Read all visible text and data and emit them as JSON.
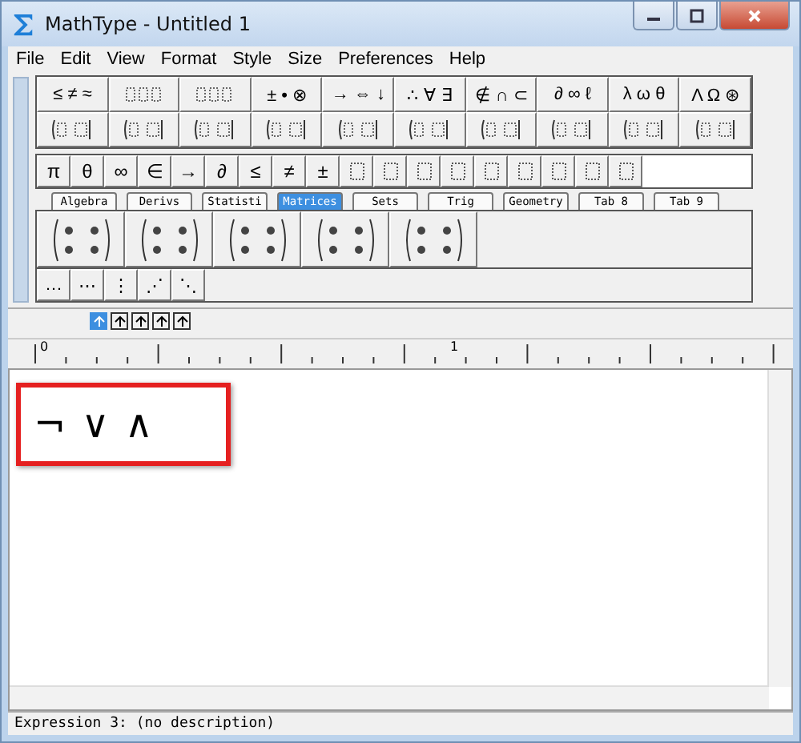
{
  "window": {
    "title": "MathType - Untitled 1"
  },
  "menu": [
    "File",
    "Edit",
    "View",
    "Format",
    "Style",
    "Size",
    "Preferences",
    "Help"
  ],
  "symbol_palettes": [
    {
      "kind": "text",
      "label": "≤ ≠ ≈"
    },
    {
      "kind": "icon"
    },
    {
      "kind": "icon"
    },
    {
      "kind": "text",
      "label": "± • ⊗"
    },
    {
      "kind": "text",
      "label": "→ ⇔ ↓"
    },
    {
      "kind": "text",
      "label": "∴ ∀ ∃"
    },
    {
      "kind": "text",
      "label": "∉ ∩ ⊂"
    },
    {
      "kind": "text",
      "label": "∂ ∞ ℓ"
    },
    {
      "kind": "text",
      "label": "λ ω θ"
    },
    {
      "kind": "text",
      "label": "Λ Ω ⊛"
    }
  ],
  "template_palettes": [
    {
      "kind": "icon"
    },
    {
      "kind": "icon"
    },
    {
      "kind": "icon"
    },
    {
      "kind": "icon"
    },
    {
      "kind": "icon"
    },
    {
      "kind": "icon"
    },
    {
      "kind": "icon"
    },
    {
      "kind": "icon"
    },
    {
      "kind": "icon"
    },
    {
      "kind": "icon"
    }
  ],
  "small_bar": [
    {
      "kind": "text",
      "label": "π"
    },
    {
      "kind": "text",
      "label": "θ"
    },
    {
      "kind": "text",
      "label": "∞"
    },
    {
      "kind": "text",
      "label": "∈"
    },
    {
      "kind": "text",
      "label": "→"
    },
    {
      "kind": "text",
      "label": "∂"
    },
    {
      "kind": "text",
      "label": "≤"
    },
    {
      "kind": "text",
      "label": "≠"
    },
    {
      "kind": "text",
      "label": "±"
    },
    {
      "kind": "icon"
    },
    {
      "kind": "icon"
    },
    {
      "kind": "icon"
    },
    {
      "kind": "icon"
    },
    {
      "kind": "icon"
    },
    {
      "kind": "icon"
    },
    {
      "kind": "icon"
    },
    {
      "kind": "icon"
    },
    {
      "kind": "icon"
    }
  ],
  "tabs": [
    {
      "label": "Algebra",
      "selected": false
    },
    {
      "label": "Derivs",
      "selected": false
    },
    {
      "label": "Statisti",
      "selected": false
    },
    {
      "label": "Matrices",
      "selected": true
    },
    {
      "label": "Sets",
      "selected": false
    },
    {
      "label": "Trig",
      "selected": false
    },
    {
      "label": "Geometry",
      "selected": false
    },
    {
      "label": "Tab 8",
      "selected": false
    },
    {
      "label": "Tab 9",
      "selected": false
    }
  ],
  "matrix_templates": [
    {
      "kind": "icon"
    },
    {
      "kind": "icon"
    },
    {
      "kind": "icon"
    },
    {
      "kind": "icon"
    },
    {
      "kind": "icon"
    }
  ],
  "dots_bar": [
    {
      "kind": "text",
      "label": "…"
    },
    {
      "kind": "text",
      "label": "⋯"
    },
    {
      "kind": "text",
      "label": "⋮"
    },
    {
      "kind": "text",
      "label": "⋰"
    },
    {
      "kind": "text",
      "label": "⋱"
    }
  ],
  "nudge_buttons": [
    {
      "selected": true
    },
    {
      "selected": false
    },
    {
      "selected": false
    },
    {
      "selected": false
    },
    {
      "selected": false
    }
  ],
  "ruler": {
    "labels": [
      "0",
      "1"
    ]
  },
  "equation": {
    "text": "¬ ∨ ∧",
    "highlighted": true
  },
  "status_bar": "Expression 3: (no description)"
}
